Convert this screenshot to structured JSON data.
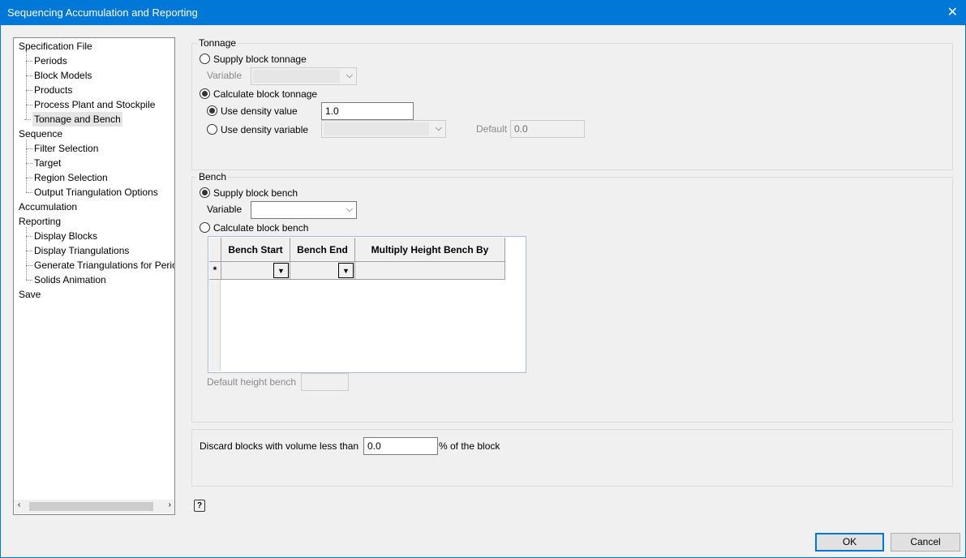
{
  "window": {
    "title": "Sequencing Accumulation and Reporting",
    "close": "✕"
  },
  "tree": [
    {
      "label": "Specification File",
      "level": 1
    },
    {
      "label": "Periods",
      "level": 2
    },
    {
      "label": "Block Models",
      "level": 2
    },
    {
      "label": "Products",
      "level": 2
    },
    {
      "label": "Process Plant and Stockpile",
      "level": 2
    },
    {
      "label": "Tonnage and Bench",
      "level": 2,
      "selected": true
    },
    {
      "label": "Sequence",
      "level": 1
    },
    {
      "label": "Filter Selection",
      "level": 2
    },
    {
      "label": "Target",
      "level": 2
    },
    {
      "label": "Region Selection",
      "level": 2
    },
    {
      "label": "Output Triangulation Options",
      "level": 2
    },
    {
      "label": "Accumulation",
      "level": 1
    },
    {
      "label": "Reporting",
      "level": 1
    },
    {
      "label": "Display Blocks",
      "level": 2
    },
    {
      "label": "Display Triangulations",
      "level": 2
    },
    {
      "label": "Generate Triangulations for Periods",
      "level": 2
    },
    {
      "label": "Solids Animation",
      "level": 2
    },
    {
      "label": "Save",
      "level": 1
    }
  ],
  "tonnage": {
    "title": "Tonnage",
    "supply": "Supply block tonnage",
    "variable_label": "Variable",
    "calculate": "Calculate block tonnage",
    "use_density_value": "Use density value",
    "density_value": "1.0",
    "use_density_variable": "Use density variable",
    "default_label": "Default",
    "default_value": "0.0"
  },
  "bench": {
    "title": "Bench",
    "supply": "Supply block bench",
    "variable_label": "Variable",
    "calculate": "Calculate block bench",
    "columns": [
      "Bench Start",
      "Bench End",
      "Multiply Height Bench By"
    ],
    "new_row_marker": "*",
    "default_height_label": "Default height bench"
  },
  "discard": {
    "label": "Discard blocks with volume less than",
    "value": "0.0",
    "suffix": "% of the block"
  },
  "buttons": {
    "ok": "OK",
    "cancel": "Cancel",
    "help": "?"
  }
}
